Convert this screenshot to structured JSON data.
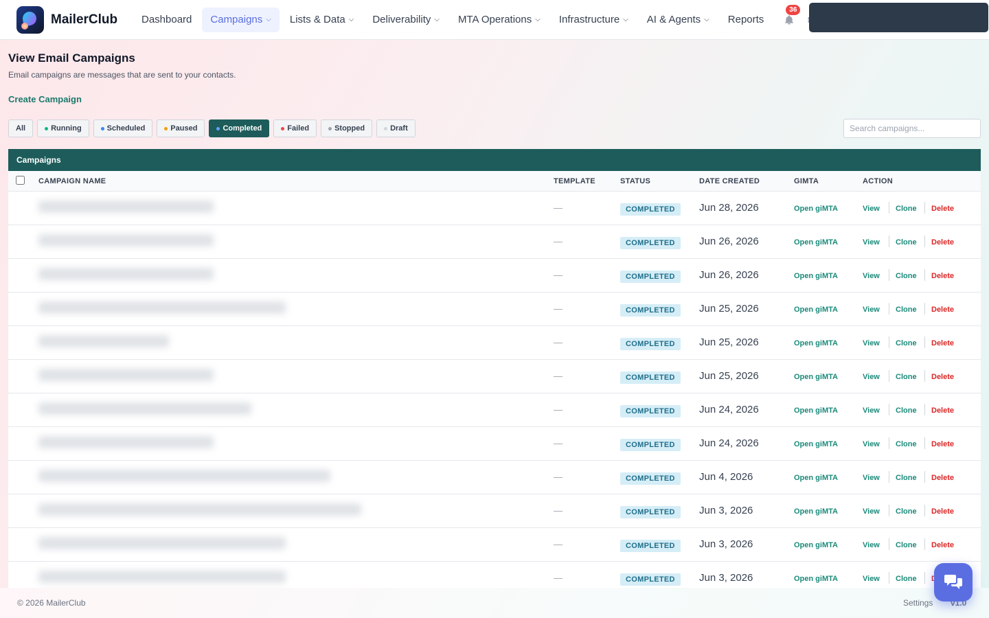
{
  "app": {
    "name": "MailerClub"
  },
  "nav": {
    "items": [
      {
        "label": "Dashboard",
        "has_menu": false,
        "active": false
      },
      {
        "label": "Campaigns",
        "has_menu": true,
        "active": true
      },
      {
        "label": "Lists & Data",
        "has_menu": true,
        "active": false
      },
      {
        "label": "Deliverability",
        "has_menu": true,
        "active": false
      },
      {
        "label": "MTA Operations",
        "has_menu": true,
        "active": false
      },
      {
        "label": "Infrastructure",
        "has_menu": true,
        "active": false
      },
      {
        "label": "AI & Agents",
        "has_menu": true,
        "active": false
      },
      {
        "label": "Reports",
        "has_menu": false,
        "active": false
      }
    ],
    "notification_count": "36",
    "icons": {
      "bell": "bell-icon",
      "settings": "gear-icon"
    }
  },
  "page": {
    "title": "View Email Campaigns",
    "subtitle": "Email campaigns are messages that are sent to your contacts.",
    "create_link": "Create Campaign"
  },
  "filters": [
    {
      "label": "All",
      "dot": null,
      "active": false
    },
    {
      "label": "Running",
      "dot": "#10b981",
      "active": false
    },
    {
      "label": "Scheduled",
      "dot": "#3b82f6",
      "active": false
    },
    {
      "label": "Paused",
      "dot": "#f59e0b",
      "active": false
    },
    {
      "label": "Completed",
      "dot": "#60a5fa",
      "active": true
    },
    {
      "label": "Failed",
      "dot": "#ef4444",
      "active": false
    },
    {
      "label": "Stopped",
      "dot": "#9ca3af",
      "active": false
    },
    {
      "label": "Draft",
      "dot": "#d1d5db",
      "active": false
    }
  ],
  "search": {
    "placeholder": "Search campaigns...",
    "value": ""
  },
  "table": {
    "title": "Campaigns",
    "columns": {
      "name": "CAMPAIGN NAME",
      "template": "TEMPLATE",
      "status": "STATUS",
      "date": "DATE CREATED",
      "gimta": "GIMTA",
      "action": "ACTION"
    },
    "actions": {
      "gimta": "Open giMTA",
      "view": "View",
      "clone": "Clone",
      "delete": "Delete"
    },
    "rows": [
      {
        "template": "—",
        "status": "COMPLETED",
        "date": "Jun 28, 2026"
      },
      {
        "template": "—",
        "status": "COMPLETED",
        "date": "Jun 26, 2026"
      },
      {
        "template": "—",
        "status": "COMPLETED",
        "date": "Jun 26, 2026"
      },
      {
        "template": "—",
        "status": "COMPLETED",
        "date": "Jun 25, 2026"
      },
      {
        "template": "—",
        "status": "COMPLETED",
        "date": "Jun 25, 2026"
      },
      {
        "template": "—",
        "status": "COMPLETED",
        "date": "Jun 25, 2026"
      },
      {
        "template": "—",
        "status": "COMPLETED",
        "date": "Jun 24, 2026"
      },
      {
        "template": "—",
        "status": "COMPLETED",
        "date": "Jun 24, 2026"
      },
      {
        "template": "—",
        "status": "COMPLETED",
        "date": "Jun 4, 2026"
      },
      {
        "template": "—",
        "status": "COMPLETED",
        "date": "Jun 3, 2026"
      },
      {
        "template": "—",
        "status": "COMPLETED",
        "date": "Jun 3, 2026"
      },
      {
        "template": "—",
        "status": "COMPLETED",
        "date": "Jun 3, 2026"
      }
    ]
  },
  "footer": {
    "copyright": "© 2026 MailerClub",
    "settings": "Settings",
    "version": "v1.0"
  },
  "chat": {
    "icon": "chat-bubbles-icon"
  }
}
